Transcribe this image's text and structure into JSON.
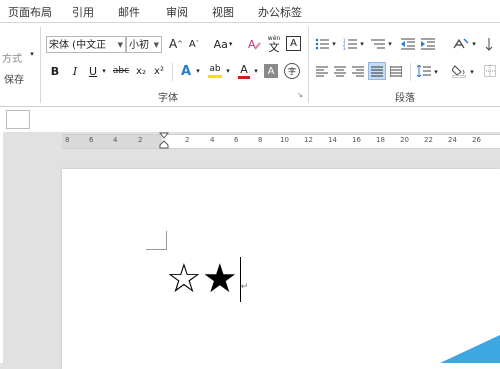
{
  "menu": [
    "页面布局",
    "引用",
    "邮件",
    "审阅",
    "视图",
    "办公标签"
  ],
  "ribbon": {
    "left_group": {
      "fangshi_label": "方式",
      "baocun_label": "保存"
    },
    "font": {
      "name_value": "宋体 (中文正",
      "size_value": "小初",
      "group_label": "字体",
      "grow_label": "A",
      "shrink_label": "A",
      "case_label": "Aa",
      "bold_label": "B",
      "italic_label": "I",
      "underline_label": "U",
      "strike_label": "abc",
      "subscript_label": "x₂",
      "superscript_label": "x²",
      "clear_format_label": "A",
      "pinyin_label": "文",
      "border_char_label": "A",
      "highlight_label": "ab",
      "font_color_label": "A",
      "shading_label": "A",
      "enclose_label": "字"
    },
    "paragraph": {
      "group_label": "段落"
    }
  },
  "ruler_ticks": [
    "8",
    "6",
    "4",
    "2",
    "",
    "2",
    "4",
    "6",
    "8",
    "10",
    "12",
    "14",
    "16",
    "18",
    "20",
    "22",
    "24",
    "26"
  ],
  "document": {
    "line_text": "☆★",
    "para_mark": "↵"
  },
  "colors": {
    "font_red": "#d41c1c",
    "highlight_yellow": "#f5e300",
    "accent_blue": "#2a7bd0",
    "selected_align": "#c5dcf5"
  }
}
